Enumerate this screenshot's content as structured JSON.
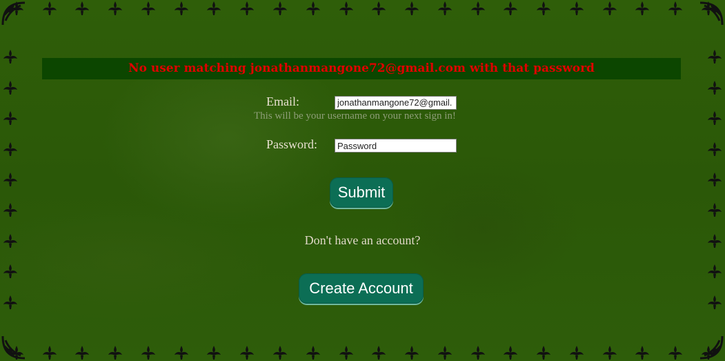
{
  "error": {
    "message": "No user matching jonathanmangone72@gmail.com with that password",
    "color": "#e00000",
    "background": "#0c4600"
  },
  "form": {
    "email_label": "Email:",
    "email_value": "jonathanmangone72@gmail.",
    "email_hint": "This will be your username on your next sign in!",
    "password_label": "Password:",
    "password_placeholder": "Password",
    "submit_label": "Submit"
  },
  "signup": {
    "prompt": "Don't have an account?",
    "create_label": "Create Account"
  },
  "theme": {
    "background": "#2c5a08",
    "button": "#0c6e55",
    "ornament_icon": "fleur-de-lis-icon"
  }
}
